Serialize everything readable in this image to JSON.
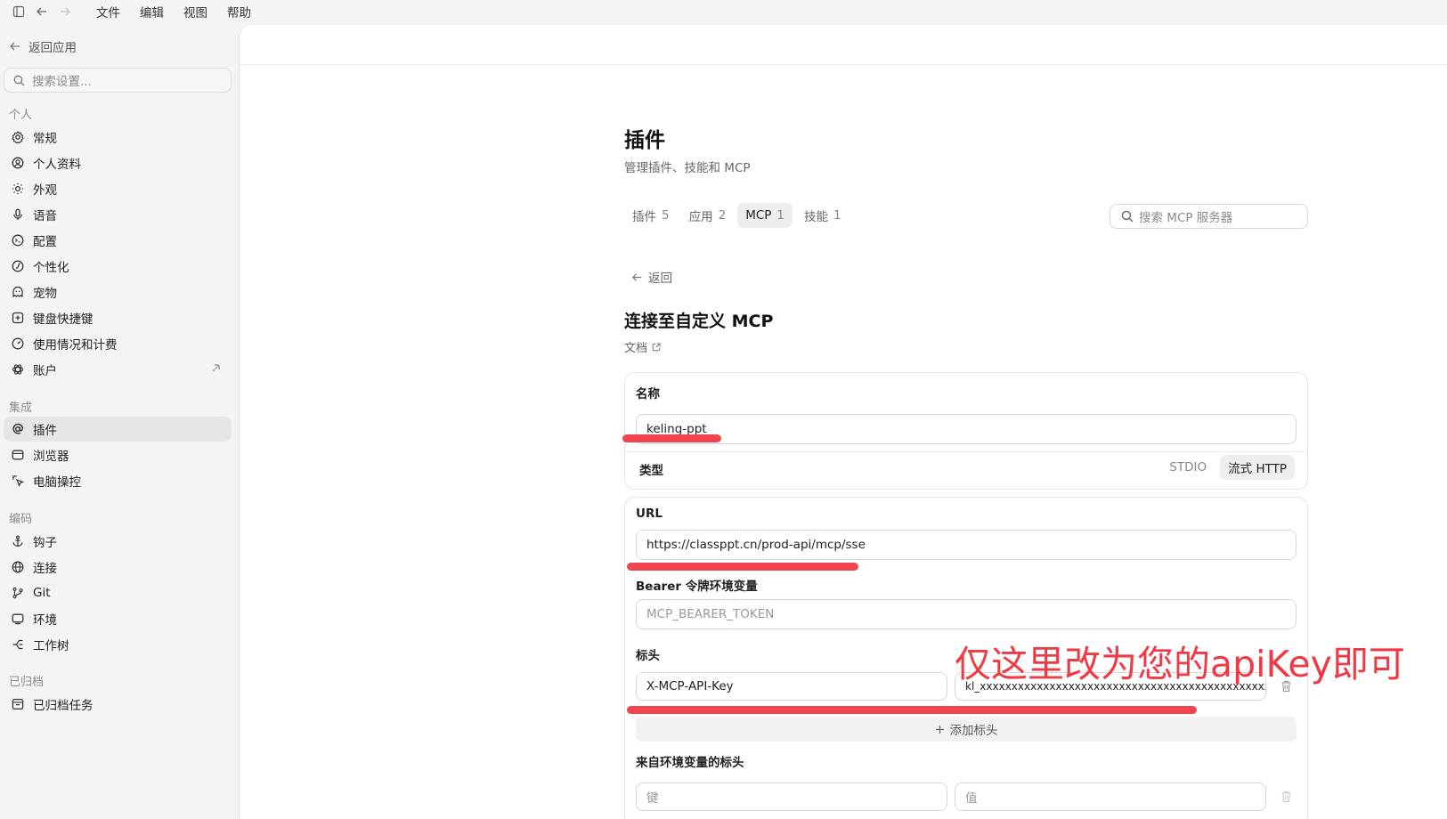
{
  "menubar": {
    "items": [
      "文件",
      "编辑",
      "视图",
      "帮助"
    ]
  },
  "sidebar": {
    "back_label": "返回应用",
    "search_placeholder": "搜索设置...",
    "sections": {
      "personal": "个人",
      "integration": "集成",
      "coding": "编码",
      "archived": "已归档"
    },
    "items": {
      "general": "常规",
      "profile": "个人资料",
      "appearance": "外观",
      "voice": "语音",
      "config": "配置",
      "personalize": "个性化",
      "pet": "宠物",
      "shortcuts": "键盘快捷键",
      "usage": "使用情况和计费",
      "account": "账户",
      "plugins": "插件",
      "browser": "浏览器",
      "computer_control": "电脑操控",
      "hooks": "钩子",
      "connections": "连接",
      "git": "Git",
      "environment": "环境",
      "worktree": "工作树",
      "archived_tasks": "已归档任务"
    },
    "active_item": "plugins"
  },
  "main": {
    "title": "插件",
    "subtitle": "管理插件、技能和 MCP",
    "tabs": [
      {
        "label": "插件",
        "count": "5"
      },
      {
        "label": "应用",
        "count": "2"
      },
      {
        "label": "MCP",
        "count": "1"
      },
      {
        "label": "技能",
        "count": "1"
      }
    ],
    "active_tab": "MCP",
    "search_placeholder": "搜索 MCP 服务器",
    "back_label": "返回",
    "form_title": "连接至自定义 MCP",
    "docs_label": "文档",
    "form": {
      "name_label": "名称",
      "name_value": "keling-ppt",
      "type_label": "类型",
      "type_options": [
        "STDIO",
        "流式 HTTP"
      ],
      "type_selected": "流式 HTTP",
      "url_label": "URL",
      "url_value": "https://classppt.cn/prod-api/mcp/sse",
      "bearer_label": "Bearer 令牌环境变量",
      "bearer_placeholder": "MCP_BEARER_TOKEN",
      "headers_label": "标头",
      "header_key": "X-MCP-API-Key",
      "header_value": "kl_xxxxxxxxxxxxxxxxxxxxxxxxxxxxxxxxxxxxxxxxxxxxxxxx",
      "add_header_label": "添加标头",
      "env_headers_label": "来自环境变量的标头",
      "env_key_placeholder": "键",
      "env_value_placeholder": "值"
    }
  },
  "annotation": {
    "text": "仅这里改为您的apiKey即可",
    "color": "#ef3a45"
  }
}
